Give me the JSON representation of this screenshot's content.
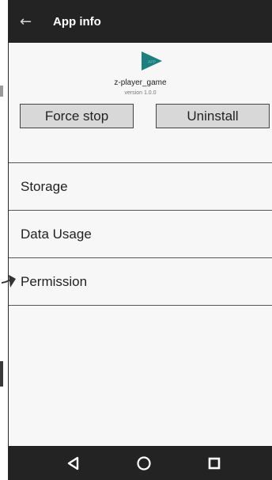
{
  "app_bar": {
    "title": "App info",
    "back_icon": "back-arrow-icon"
  },
  "app": {
    "name": "z-player_game",
    "version": "version 1.0.0",
    "icon_badge": "APP",
    "icon_color": "#1e7f7f"
  },
  "actions": {
    "force_stop_label": "Force stop",
    "uninstall_label": "Uninstall"
  },
  "settings_items": [
    {
      "label": "Storage"
    },
    {
      "label": "Data Usage"
    },
    {
      "label": "Permission"
    }
  ],
  "nav_bar": {
    "back_icon": "nav-back-triangle-icon",
    "home_icon": "nav-home-circle-icon",
    "recents_icon": "nav-recents-square-icon"
  },
  "colors": {
    "bar_background": "#232323",
    "button_background": "#d8d8d8"
  }
}
